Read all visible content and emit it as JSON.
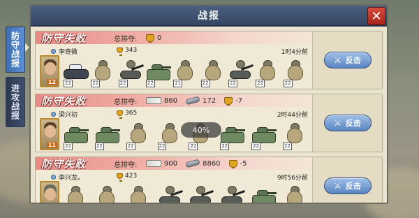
{
  "window": {
    "title": "战报",
    "close_glyph": "✕"
  },
  "side_tabs": [
    {
      "label": "防守战报",
      "active": true
    },
    {
      "label": "进攻战报",
      "active": false
    }
  ],
  "overlay": {
    "zoom_label": "40%"
  },
  "reports": [
    {
      "result": "防守失败",
      "total_label": "总排夺:",
      "stats": [
        {
          "icon": "trophy-icon",
          "value": "0"
        }
      ],
      "player": "李奇微",
      "score": "343",
      "time": "1时4分前",
      "avatar_level": "12",
      "avatar_style": "plain",
      "units": [
        {
          "kind": "car",
          "level": "22"
        },
        {
          "kind": "soldier",
          "level": "22"
        },
        {
          "kind": "gun",
          "level": "22"
        },
        {
          "kind": "tank",
          "level": "22"
        },
        {
          "kind": "soldier",
          "level": "21"
        },
        {
          "kind": "soldier",
          "level": "22"
        },
        {
          "kind": "gun",
          "level": "22"
        },
        {
          "kind": "soldier",
          "level": "22"
        },
        {
          "kind": "soldier",
          "level": "22"
        }
      ],
      "action_label": "反击"
    },
    {
      "result": "防守失败",
      "total_label": "总排夺:",
      "stats": [
        {
          "icon": "cash-icon",
          "value": "860"
        },
        {
          "icon": "steel-icon",
          "value": "172"
        },
        {
          "icon": "trophy-icon",
          "value": "-7"
        }
      ],
      "player": "梁兴初",
      "score": "365",
      "time": "2时44分前",
      "avatar_level": "11",
      "avatar_style": "plain",
      "units": [
        {
          "kind": "tank",
          "level": "22"
        },
        {
          "kind": "tank",
          "level": "22"
        },
        {
          "kind": "soldier",
          "level": "22"
        },
        {
          "kind": "soldier",
          "level": "22"
        },
        {
          "kind": "soldier",
          "level": "22"
        },
        {
          "kind": "tank",
          "level": "22"
        },
        {
          "kind": "tank",
          "level": "22"
        },
        {
          "kind": "soldier",
          "level": "22"
        }
      ],
      "action_label": "反击"
    },
    {
      "result": "防守失败",
      "total_label": "总排夺:",
      "stats": [
        {
          "icon": "cash-icon",
          "value": "900"
        },
        {
          "icon": "steel-icon",
          "value": "8860"
        },
        {
          "icon": "trophy-icon",
          "value": "-5"
        }
      ],
      "player": "李兴龙。",
      "score": "423",
      "time": "9时56分前",
      "avatar_level": "",
      "avatar_style": "helmet",
      "units": [
        {
          "kind": "soldier",
          "level": ""
        },
        {
          "kind": "soldier",
          "level": ""
        },
        {
          "kind": "soldier",
          "level": ""
        },
        {
          "kind": "gun",
          "level": ""
        },
        {
          "kind": "gun",
          "level": ""
        },
        {
          "kind": "gun",
          "level": ""
        },
        {
          "kind": "tank",
          "level": ""
        },
        {
          "kind": "soldier",
          "level": ""
        }
      ],
      "action_label": "反击"
    }
  ],
  "colors": {
    "title_bar": "#344661",
    "result_banner": "#e98a86",
    "counter_button": "#5b85c2",
    "close_button": "#c0392b"
  }
}
